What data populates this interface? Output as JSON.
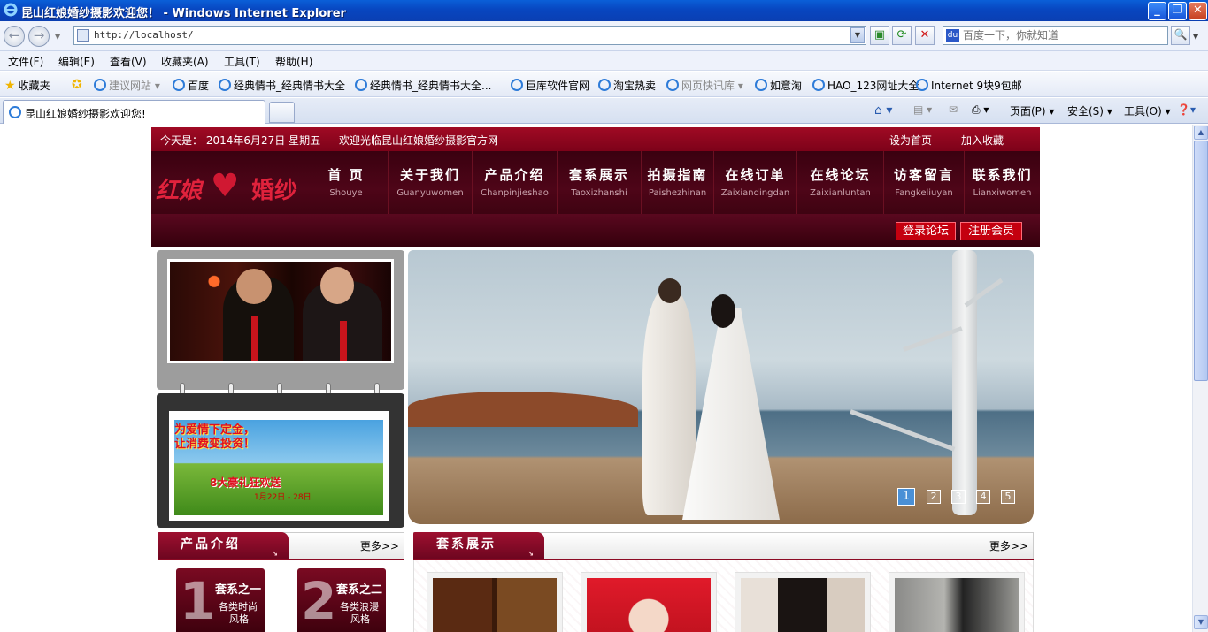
{
  "window": {
    "title": "昆山红娘婚纱摄影欢迎您！ - Windows Internet Explorer"
  },
  "address": {
    "url": "http://localhost/",
    "search_placeholder": "百度一下，你就知道"
  },
  "menu": [
    "文件(F)",
    "编辑(E)",
    "查看(V)",
    "收藏夹(A)",
    "工具(T)",
    "帮助(H)"
  ],
  "favorites": {
    "label": "收藏夹",
    "items": [
      "建议网站",
      "百度",
      "经典情书_经典情书大全",
      "经典情书_经典情书大全...",
      "巨库软件官网",
      "淘宝热卖",
      "网页快讯库",
      "如意淘",
      "HAO_123网址大全",
      "Internet 9块9包邮"
    ]
  },
  "tabs": {
    "active": "昆山红娘婚纱摄影欢迎您!",
    "toolbar": [
      "页面(P)",
      "安全(S)",
      "工具(O)"
    ]
  },
  "site": {
    "date_text": "今天是： 2014年6月27日 星期五",
    "welcome": "欢迎光临昆山红娘婚纱摄影官方网",
    "set_home": "设为首页",
    "add_fav": "加入收藏",
    "logo_left": "红娘",
    "logo_right": "婚纱",
    "nav": [
      {
        "cn": "首  页",
        "py": "Shouye"
      },
      {
        "cn": "关于我们",
        "py": "Guanyuwomen"
      },
      {
        "cn": "产品介绍",
        "py": "Chanpinjieshao"
      },
      {
        "cn": "套系展示",
        "py": "Taoxizhanshi"
      },
      {
        "cn": "拍摄指南",
        "py": "Paishezhinan"
      },
      {
        "cn": "在线订单",
        "py": "Zaixiandingdan"
      },
      {
        "cn": "在线论坛",
        "py": "Zaixianluntan"
      },
      {
        "cn": "访客留言",
        "py": "Fangkeliuyan"
      },
      {
        "cn": "联系我们",
        "py": "Lianxiwomen"
      }
    ],
    "login_forum": "登录论坛",
    "register": "注册会员",
    "promo_line1": "为爱情下定金，",
    "promo_line2": "让消费变投资！",
    "promo_line3": "8大豪礼狂欢送",
    "promo_line4": "1月22日 - 28日",
    "slides": [
      "1",
      "2",
      "3",
      "4",
      "5"
    ],
    "product_section": {
      "title": "产品介绍",
      "more": "更多>>"
    },
    "series_section": {
      "title": "套系展示",
      "more": "更多>>"
    },
    "products": [
      {
        "num": "1",
        "title": "套系之一",
        "line1": "各类时尚",
        "line2": "风格"
      },
      {
        "num": "2",
        "title": "套系之二",
        "line1": "各类浪漫",
        "line2": "风格"
      }
    ]
  },
  "colors": {
    "brand_red": "#8c0a24",
    "ie_blue": "#0846c0"
  }
}
